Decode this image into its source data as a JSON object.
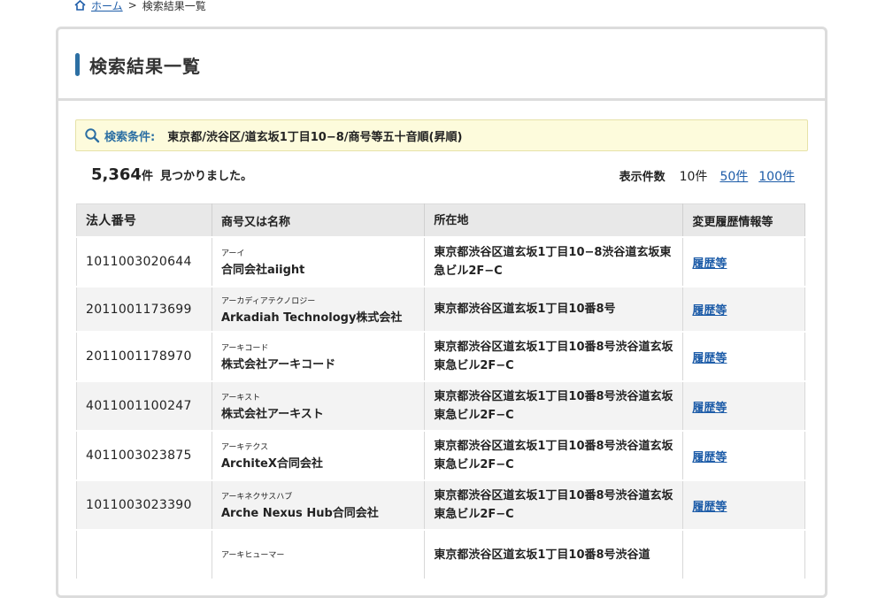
{
  "breadcrumb": {
    "home": "ホーム",
    "separator": ">",
    "current": "検索結果一覧"
  },
  "page_title": "検索結果一覧",
  "search_condition": {
    "label": "検索条件:",
    "value": "東京都/渋谷区/道玄坂1丁目10−8/商号等五十音順(昇順)"
  },
  "result": {
    "count": "5,364",
    "unit": "件",
    "suffix": "見つかりました。"
  },
  "per_page": {
    "label": "表示件数",
    "current": "10件",
    "options": [
      "50件",
      "100件"
    ]
  },
  "table": {
    "headers": [
      "法人番号",
      "商号又は名称",
      "所在地",
      "変更履歴情報等"
    ],
    "rows": [
      {
        "number": "1011003020644",
        "kana": "アーイ",
        "name": "合同会社aiight",
        "address": "東京都渋谷区道玄坂1丁目10−8渋谷道玄坂東急ビル2F−C",
        "history": "履歴等"
      },
      {
        "number": "2011001173699",
        "kana": "アーカディアテクノロジー",
        "name": "Arkadiah Technology株式会社",
        "address": "東京都渋谷区道玄坂1丁目10番8号",
        "history": "履歴等"
      },
      {
        "number": "2011001178970",
        "kana": "アーキコード",
        "name": "株式会社アーキコード",
        "address": "東京都渋谷区道玄坂1丁目10番8号渋谷道玄坂東急ビル2F−C",
        "history": "履歴等"
      },
      {
        "number": "4011001100247",
        "kana": "アーキスト",
        "name": "株式会社アーキスト",
        "address": "東京都渋谷区道玄坂1丁目10番8号渋谷道玄坂東急ビル2F−C",
        "history": "履歴等"
      },
      {
        "number": "4011003023875",
        "kana": "アーキテクス",
        "name": "ArchiteX合同会社",
        "address": "東京都渋谷区道玄坂1丁目10番8号渋谷道玄坂東急ビル2F−C",
        "history": "履歴等"
      },
      {
        "number": "1011003023390",
        "kana": "アーキネクサスハブ",
        "name": "Arche Nexus Hub合同会社",
        "address": "東京都渋谷区道玄坂1丁目10番8号渋谷道玄坂東急ビル2F−C",
        "history": "履歴等"
      },
      {
        "number": "",
        "kana": "アーキヒューマー",
        "name": "",
        "address": "東京都渋谷区道玄坂1丁目10番8号渋谷道",
        "history": ""
      }
    ]
  }
}
